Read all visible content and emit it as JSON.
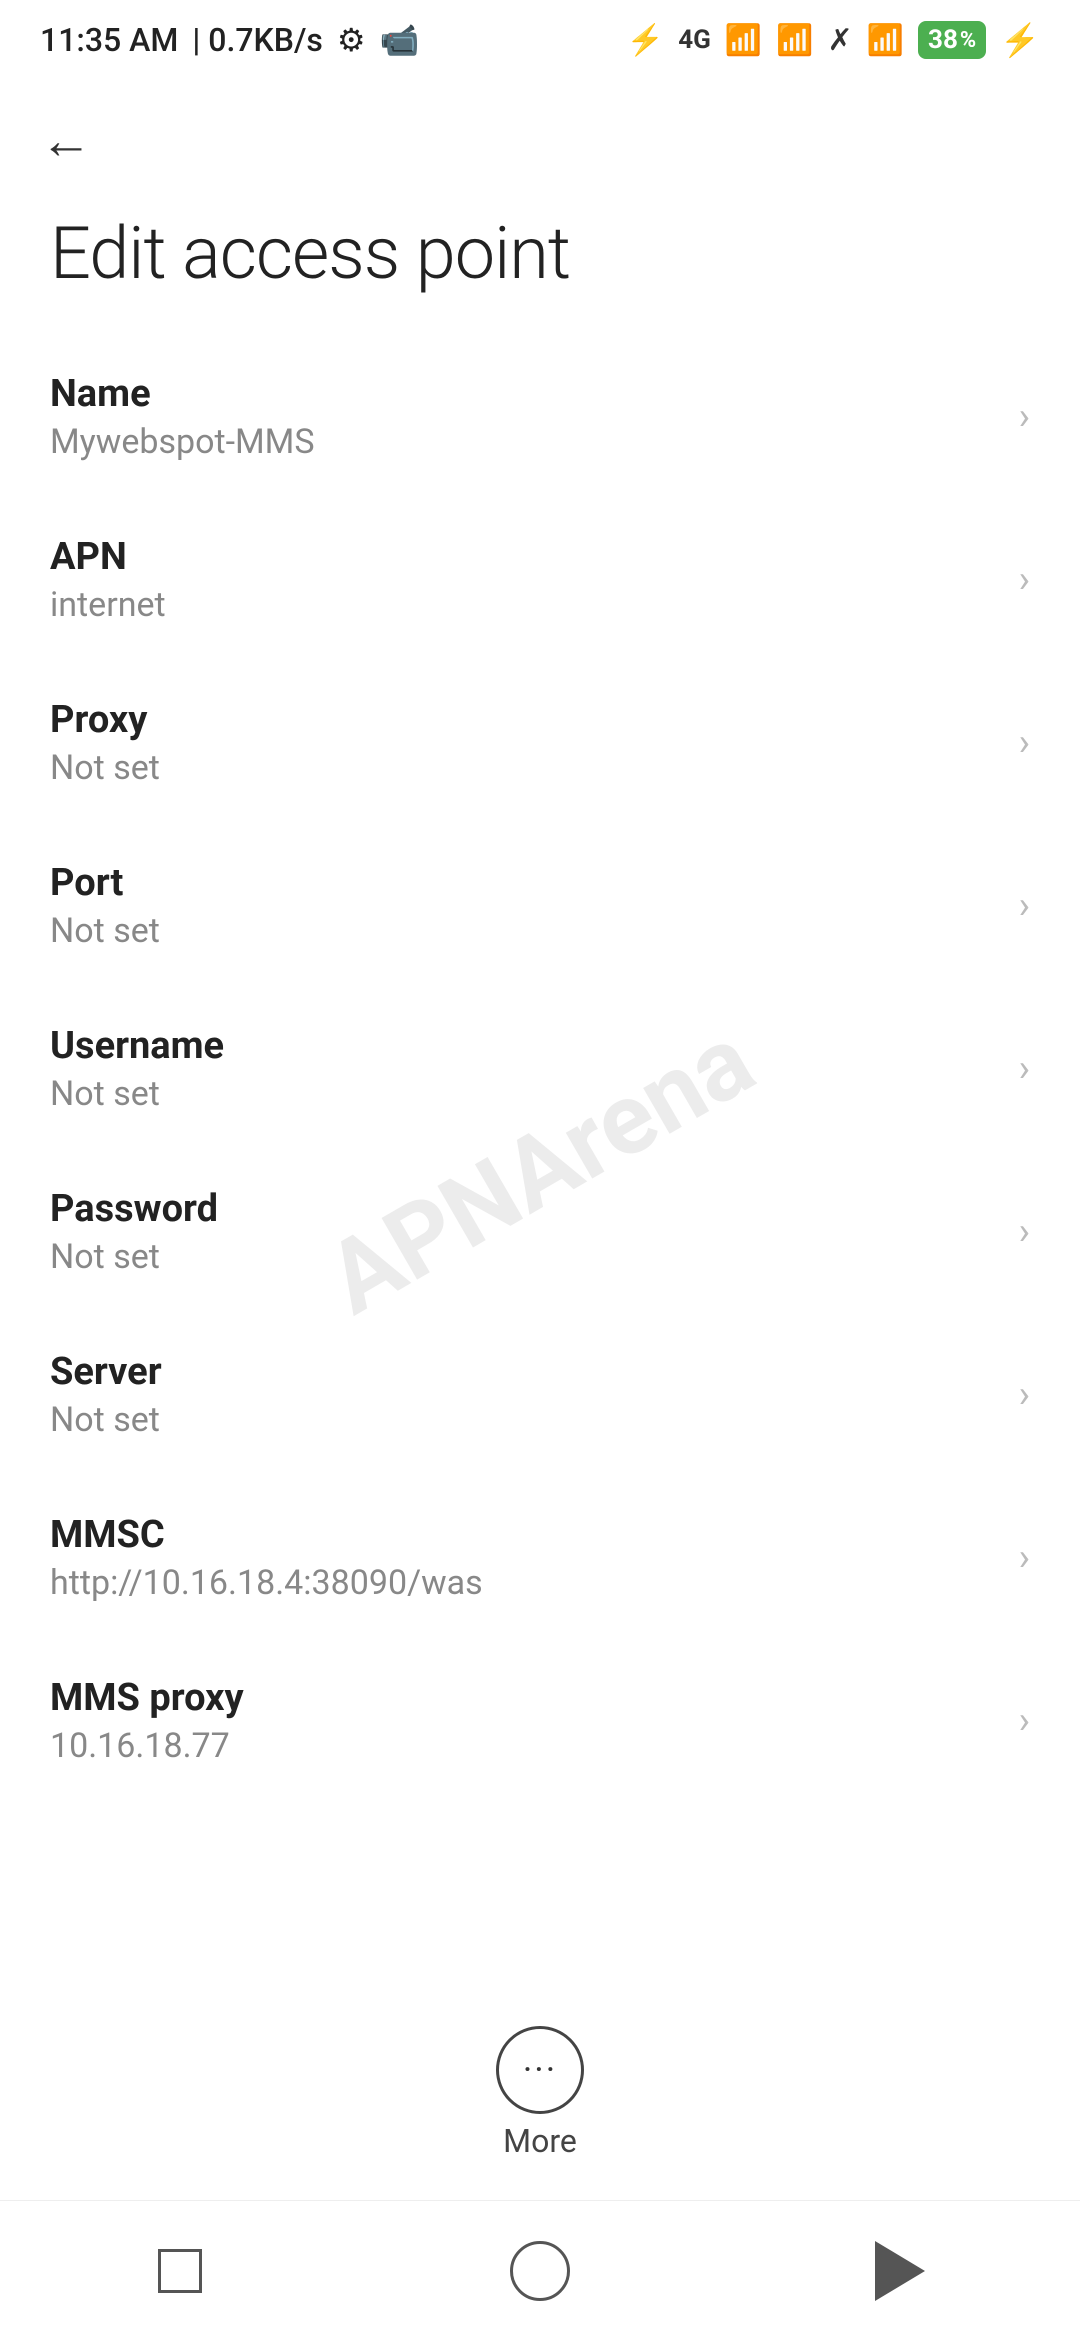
{
  "statusBar": {
    "time": "11:35 AM",
    "speed": "0.7KB/s"
  },
  "header": {
    "backLabel": "←",
    "title": "Edit access point"
  },
  "settings": [
    {
      "label": "Name",
      "value": "Mywebspot-MMS"
    },
    {
      "label": "APN",
      "value": "internet"
    },
    {
      "label": "Proxy",
      "value": "Not set"
    },
    {
      "label": "Port",
      "value": "Not set"
    },
    {
      "label": "Username",
      "value": "Not set"
    },
    {
      "label": "Password",
      "value": "Not set"
    },
    {
      "label": "Server",
      "value": "Not set"
    },
    {
      "label": "MMSC",
      "value": "http://10.16.18.4:38090/was"
    },
    {
      "label": "MMS proxy",
      "value": "10.16.18.77"
    }
  ],
  "more": {
    "label": "More"
  },
  "watermark": "APNArena"
}
